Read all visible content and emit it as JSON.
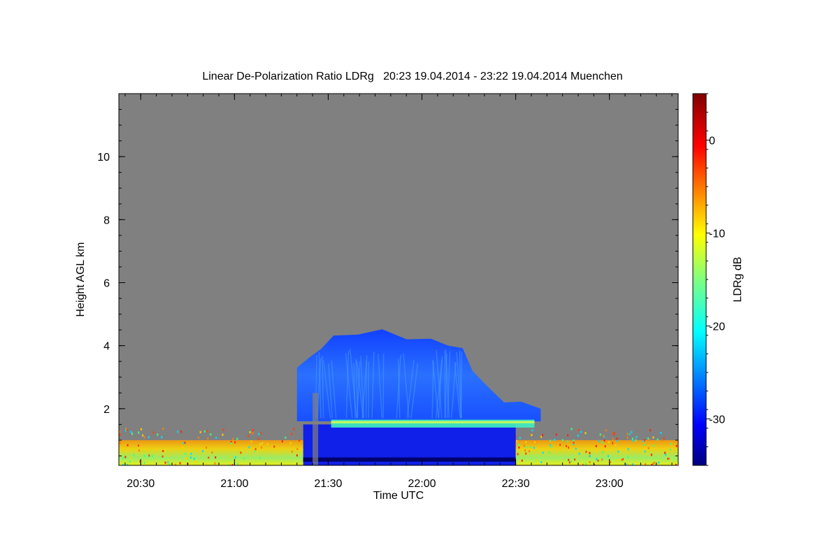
{
  "chart_data": {
    "type": "heatmap",
    "title": "Linear De-Polarization Ratio LDRg   20:23 19.04.2014 - 23:22 19.04.2014 Muenchen",
    "xlabel": "Time UTC",
    "ylabel": "Height AGL km",
    "colorbar_label": "LDRg dB",
    "x_range": [
      "20:23",
      "23:22"
    ],
    "x_ticks": [
      "20:30",
      "21:00",
      "21:30",
      "22:00",
      "22:30",
      "23:00"
    ],
    "y_range": [
      0.2,
      12.0
    ],
    "y_ticks": [
      2,
      4,
      6,
      8,
      10
    ],
    "colorbar_range": [
      -35,
      5
    ],
    "colorbar_ticks": [
      0,
      -10,
      -20,
      -30
    ],
    "colormap": "jet",
    "missing_value_color": "#808080",
    "features": [
      {
        "name": "surface layer",
        "time": [
          "20:23",
          "23:22"
        ],
        "height_km": [
          0.2,
          1.0
        ],
        "ldr_db": -10
      },
      {
        "name": "precipitation below cloud",
        "time": [
          "21:22",
          "22:30"
        ],
        "height_km": [
          0.2,
          1.5
        ],
        "ldr_db": -31
      },
      {
        "name": "melting layer bright band",
        "time": [
          "21:22",
          "22:36"
        ],
        "height_km": [
          1.4,
          1.65
        ],
        "ldr_db": -18
      },
      {
        "name": "ice cloud",
        "time": [
          "21:20",
          "22:38"
        ],
        "height_km": [
          1.6,
          4.4
        ],
        "ldr_db": -30
      }
    ]
  }
}
